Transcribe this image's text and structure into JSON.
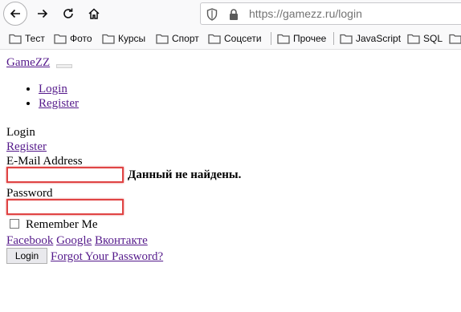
{
  "browser": {
    "url_host": "https://gamezz.ru",
    "url_path": "/login",
    "bookmarks": [
      {
        "label": "Тест"
      },
      {
        "label": "Фото"
      },
      {
        "label": "Курсы"
      },
      {
        "label": "Спорт"
      },
      {
        "label": "Соцсети"
      },
      {
        "label": "Прочее"
      },
      {
        "label": "JavaScript"
      },
      {
        "label": "SQL"
      }
    ]
  },
  "page": {
    "brand": "GameZZ",
    "nav": [
      "Login",
      "Register"
    ],
    "heading": "Login",
    "register_link": "Register",
    "email_label": "E-Mail Address",
    "email_value": "",
    "error_message": "Данный не найдены.",
    "password_label": "Password",
    "password_value": "",
    "remember_label": "Remember Me",
    "social": [
      "Facebook",
      "Google",
      "Вконтакте"
    ],
    "login_button": "Login",
    "forgot_link": "Forgot Your Password?"
  },
  "colors": {
    "link": "#551a8b",
    "error_border": "#e04444"
  }
}
